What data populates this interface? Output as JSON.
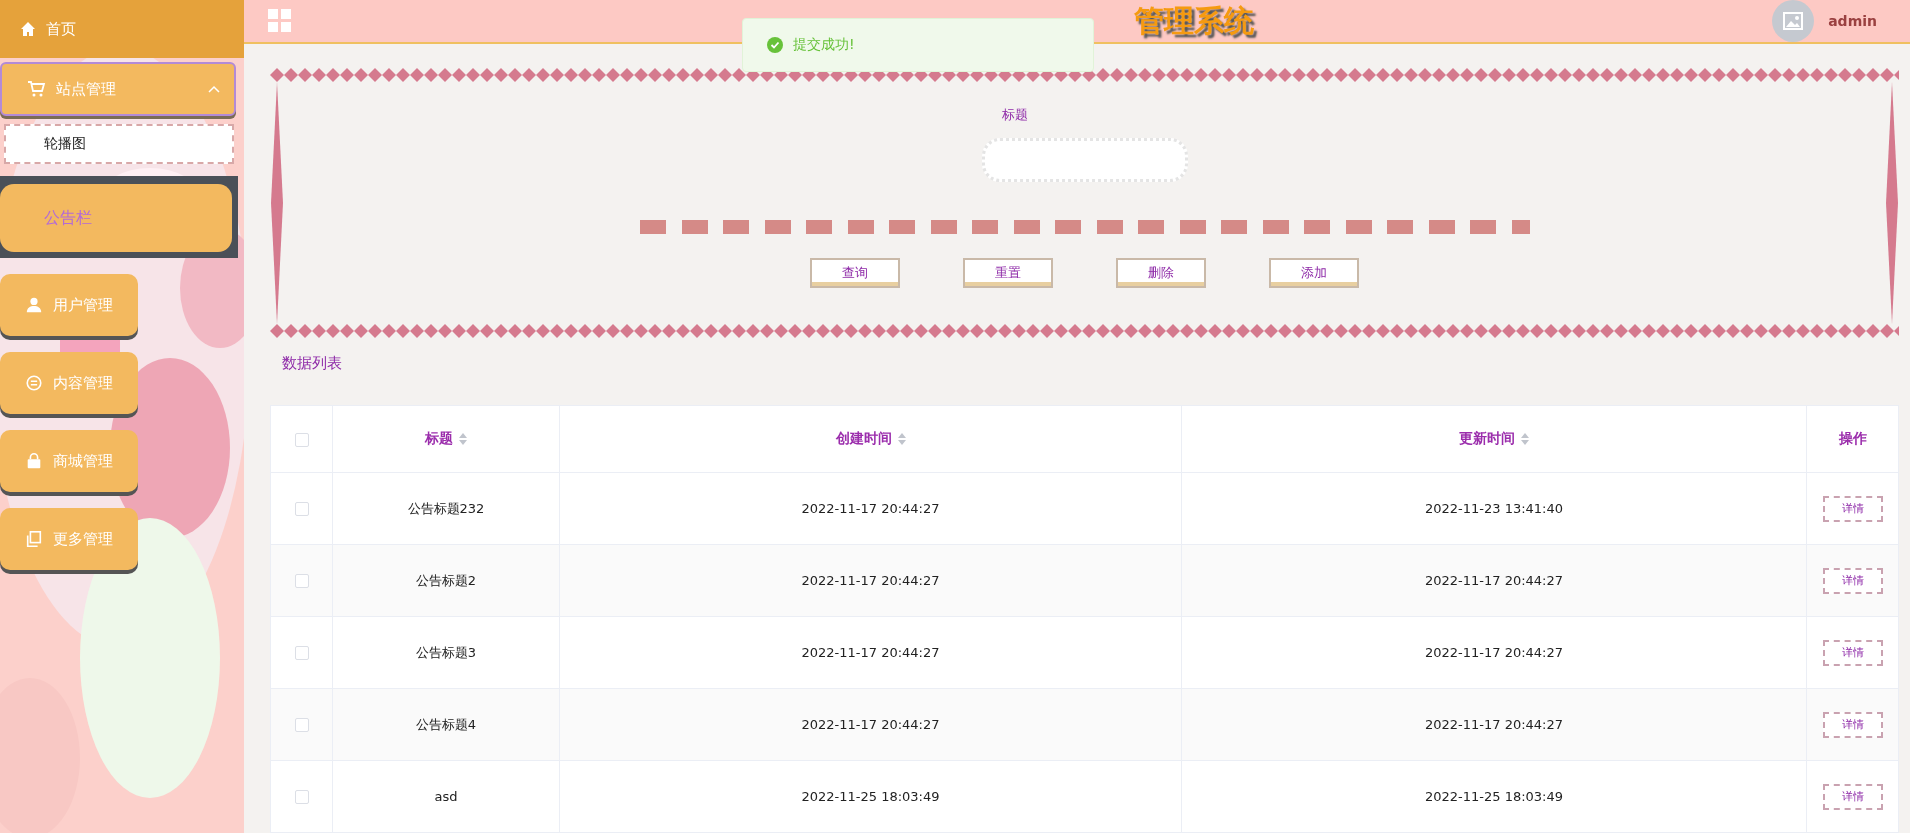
{
  "header": {
    "home": "首页",
    "title": "管理系统",
    "user": "admin"
  },
  "toast": {
    "text": "提交成功!"
  },
  "sidebar": {
    "items": [
      {
        "label": "站点管理",
        "kind": "cart",
        "expanded": true,
        "children": [
          {
            "label": "轮播图",
            "selected": false
          },
          {
            "label": "公告栏",
            "selected": true
          }
        ]
      },
      {
        "label": "用户管理",
        "kind": "user",
        "expanded": false
      },
      {
        "label": "内容管理",
        "kind": "chat",
        "expanded": false
      },
      {
        "label": "商城管理",
        "kind": "bag",
        "expanded": false
      },
      {
        "label": "更多管理",
        "kind": "copy",
        "expanded": false
      }
    ]
  },
  "search": {
    "label": "标题",
    "buttons": [
      "查询",
      "重置",
      "删除",
      "添加"
    ]
  },
  "list_title": "数据列表",
  "table": {
    "select_all": {
      "checked": false
    },
    "columns": [
      {
        "label": "标题",
        "sortable": true
      },
      {
        "label": "创建时间",
        "sortable": true
      },
      {
        "label": "更新时间",
        "sortable": true
      },
      {
        "label": "操作",
        "sortable": false
      }
    ],
    "rows": [
      {
        "checked": false,
        "cells": [
          "公告标题232",
          "2022-11-17 20:44:27",
          "2022-11-23 13:41:40"
        ],
        "action": "详情"
      },
      {
        "checked": false,
        "cells": [
          "公告标题2",
          "2022-11-17 20:44:27",
          "2022-11-17 20:44:27"
        ],
        "action": "详情"
      },
      {
        "checked": false,
        "cells": [
          "公告标题3",
          "2022-11-17 20:44:27",
          "2022-11-17 20:44:27"
        ],
        "action": "详情"
      },
      {
        "checked": false,
        "cells": [
          "公告标题4",
          "2022-11-17 20:44:27",
          "2022-11-17 20:44:27"
        ],
        "action": "详情"
      },
      {
        "checked": false,
        "cells": [
          "asd",
          "2022-11-25 18:03:49",
          "2022-11-25 18:03:49"
        ],
        "action": "详情"
      }
    ]
  }
}
